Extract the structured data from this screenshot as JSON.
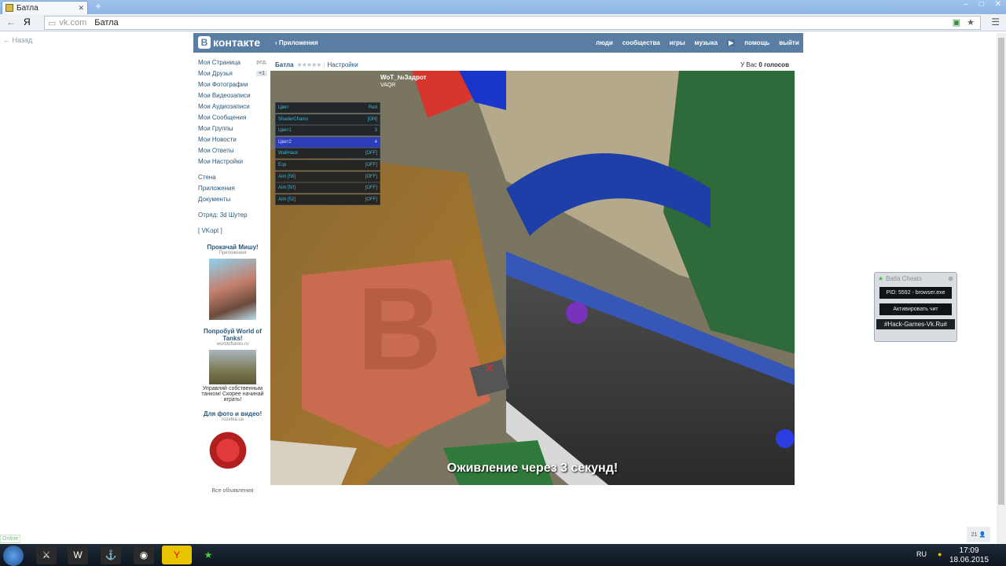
{
  "browser": {
    "tab_title": "Батла",
    "url_domain": "vk.com",
    "url_title": "Батла"
  },
  "back_label": "Назад",
  "vk": {
    "logo_text": "контакте",
    "apps_link": "Приложения",
    "top_nav": [
      "люди",
      "сообщества",
      "игры",
      "музыка",
      "помощь",
      "выйти"
    ],
    "sidebar": {
      "items": [
        {
          "label": "Моя Страница",
          "extra": "ред."
        },
        {
          "label": "Мои Друзья",
          "extra": "+1"
        },
        {
          "label": "Мои Фотографии",
          "extra": ""
        },
        {
          "label": "Мои Видеозаписи",
          "extra": ""
        },
        {
          "label": "Мои Аудиозаписи",
          "extra": ""
        },
        {
          "label": "Мои Сообщения",
          "extra": ""
        },
        {
          "label": "Мои Группы",
          "extra": ""
        },
        {
          "label": "Мои Новости",
          "extra": ""
        },
        {
          "label": "Мои Ответы",
          "extra": ""
        },
        {
          "label": "Мои Настройки",
          "extra": ""
        }
      ],
      "items2": [
        "Стена",
        "Приложения",
        "Документы"
      ],
      "squad": "Отряд: 3d Шутер",
      "vkopt": "[ VKopt ]"
    },
    "ads": [
      {
        "title": "Прокачай Мишу!",
        "sub": "Приложения",
        "text": ""
      },
      {
        "title": "Попробуй World of Tanks!",
        "sub": "worldoftanks.ru",
        "text": "Управляй собственным танком! Скорее начинай играть!"
      },
      {
        "title": "Для фото и видео!",
        "sub": "rozetka.ua",
        "text": ""
      }
    ],
    "all_ads": "Все объявления"
  },
  "content": {
    "app_title": "Батла",
    "stars": "★★★★★",
    "settings_link": "Настройки",
    "votes_prefix": "У Вас",
    "votes_count": "0 голосов"
  },
  "game": {
    "subtitle": "Оживление через 3 секунд!",
    "hud_name": "WoT_№Задрот",
    "hud_stats": "VAQR",
    "cheat_menu": [
      {
        "label": "Цвет",
        "value": "Red"
      },
      {
        "label": "ShaderChams",
        "value": "[ON]"
      },
      {
        "label": "Цвет1",
        "value": "3"
      },
      {
        "label": "Цвет2",
        "value": "4"
      },
      {
        "label": "WallHack",
        "value": "[OFF]"
      },
      {
        "label": "Esp",
        "value": "[OFF]"
      },
      {
        "label": "Aim [56]",
        "value": "[OFF]"
      },
      {
        "label": "Aim [50]",
        "value": "[OFF]"
      },
      {
        "label": "Aim [52]",
        "value": "[OFF]"
      }
    ]
  },
  "cheat_window": {
    "title": "Batla Cheats",
    "pid": "PID: 5592 - browser.exe",
    "activate": "Активировать чит",
    "footer": "#Hack-Games-Vk.Ru#"
  },
  "status": {
    "online": "Online",
    "counter": "21"
  },
  "taskbar": {
    "lang": "RU",
    "time": "17:09",
    "date": "18.06.2015"
  }
}
